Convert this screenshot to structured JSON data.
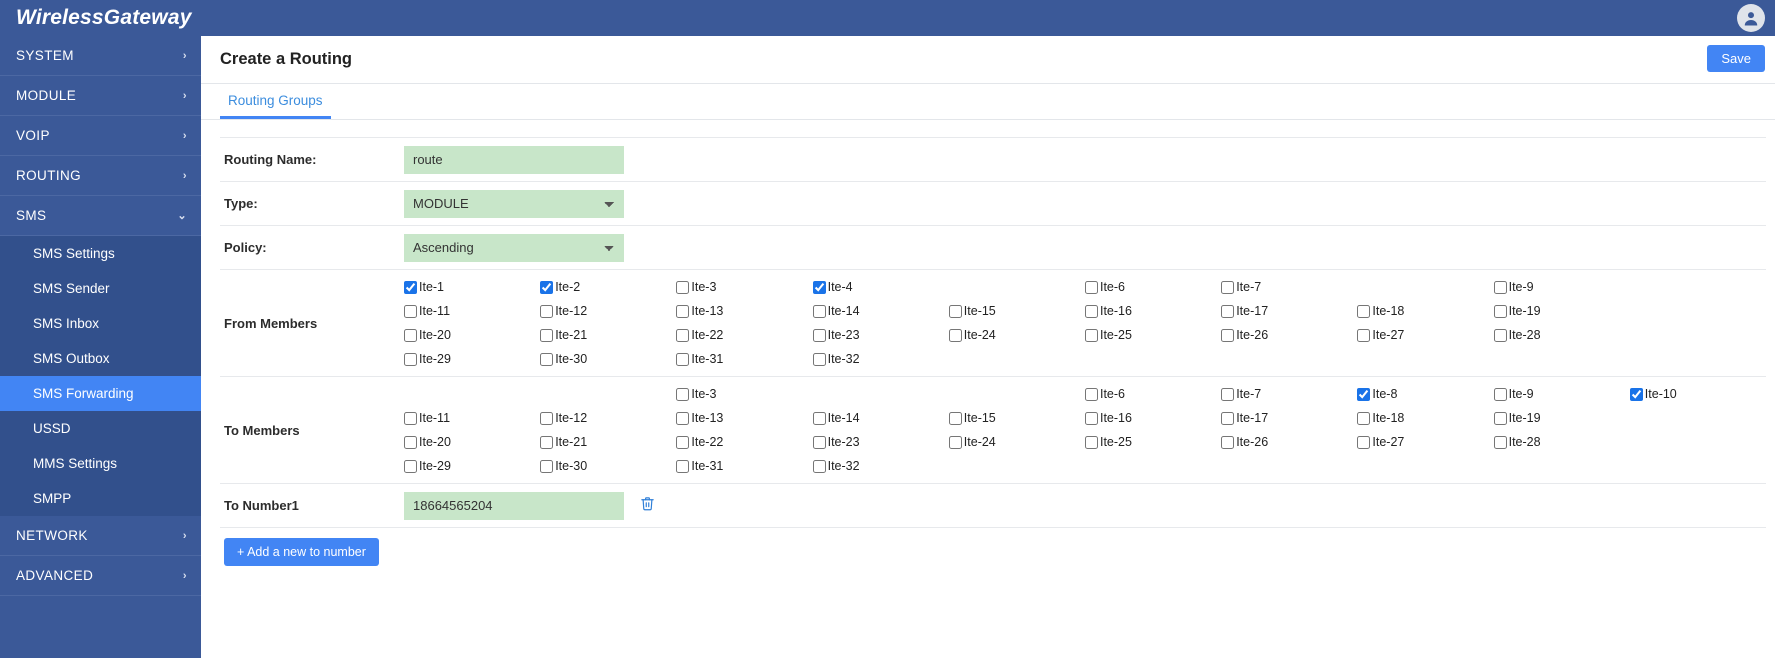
{
  "app": {
    "brand": "WirelessGateway",
    "user_icon": "user-avatar-icon"
  },
  "sidebar": {
    "groups": [
      {
        "label": "SYSTEM",
        "icon": "chevron-right-icon",
        "expanded": false,
        "children": []
      },
      {
        "label": "MODULE",
        "icon": "chevron-right-icon",
        "expanded": false,
        "children": []
      },
      {
        "label": "VOIP",
        "icon": "chevron-right-icon",
        "expanded": false,
        "children": []
      },
      {
        "label": "ROUTING",
        "icon": "chevron-right-icon",
        "expanded": false,
        "children": []
      },
      {
        "label": "SMS",
        "icon": "chevron-down-icon",
        "expanded": true,
        "children": [
          {
            "label": "SMS Settings",
            "active": false
          },
          {
            "label": "SMS Sender",
            "active": false
          },
          {
            "label": "SMS Inbox",
            "active": false
          },
          {
            "label": "SMS Outbox",
            "active": false
          },
          {
            "label": "SMS Forwarding",
            "active": true
          },
          {
            "label": "USSD",
            "active": false
          },
          {
            "label": "MMS Settings",
            "active": false
          },
          {
            "label": "SMPP",
            "active": false
          }
        ]
      },
      {
        "label": "NETWORK",
        "icon": "chevron-right-icon",
        "expanded": false,
        "children": []
      },
      {
        "label": "ADVANCED",
        "icon": "chevron-right-icon",
        "expanded": false,
        "children": []
      }
    ]
  },
  "page": {
    "title": "Create a Routing",
    "save_label": "Save",
    "tabs": [
      {
        "label": "Routing Groups",
        "active": true
      }
    ]
  },
  "form": {
    "routing_name": {
      "label": "Routing Name:",
      "value": "route",
      "placeholder": ""
    },
    "type": {
      "label": "Type:",
      "value": "MODULE",
      "options": [
        "MODULE"
      ]
    },
    "policy": {
      "label": "Policy:",
      "value": "Ascending",
      "options": [
        "Ascending"
      ]
    },
    "from_members": {
      "label": "From Members",
      "columns": 10,
      "cells": [
        {
          "label": "Ite-1",
          "checked": true
        },
        {
          "label": "Ite-2",
          "checked": true
        },
        {
          "label": "Ite-3",
          "checked": false
        },
        {
          "label": "Ite-4",
          "checked": true
        },
        {
          "label": "",
          "checked": false,
          "empty": true
        },
        {
          "label": "Ite-6",
          "checked": false
        },
        {
          "label": "Ite-7",
          "checked": false
        },
        {
          "label": "",
          "checked": false,
          "empty": true
        },
        {
          "label": "Ite-9",
          "checked": false
        },
        {
          "label": "",
          "checked": false,
          "empty": true
        },
        {
          "label": "Ite-11",
          "checked": false
        },
        {
          "label": "Ite-12",
          "checked": false
        },
        {
          "label": "Ite-13",
          "checked": false
        },
        {
          "label": "Ite-14",
          "checked": false
        },
        {
          "label": "Ite-15",
          "checked": false
        },
        {
          "label": "Ite-16",
          "checked": false
        },
        {
          "label": "Ite-17",
          "checked": false
        },
        {
          "label": "Ite-18",
          "checked": false
        },
        {
          "label": "Ite-19",
          "checked": false
        },
        {
          "label": "",
          "checked": false,
          "empty": true
        },
        {
          "label": "Ite-20",
          "checked": false
        },
        {
          "label": "Ite-21",
          "checked": false
        },
        {
          "label": "Ite-22",
          "checked": false
        },
        {
          "label": "Ite-23",
          "checked": false
        },
        {
          "label": "Ite-24",
          "checked": false
        },
        {
          "label": "Ite-25",
          "checked": false
        },
        {
          "label": "Ite-26",
          "checked": false
        },
        {
          "label": "Ite-27",
          "checked": false
        },
        {
          "label": "Ite-28",
          "checked": false
        },
        {
          "label": "",
          "checked": false,
          "empty": true
        },
        {
          "label": "Ite-29",
          "checked": false
        },
        {
          "label": "Ite-30",
          "checked": false
        },
        {
          "label": "Ite-31",
          "checked": false
        },
        {
          "label": "Ite-32",
          "checked": false
        },
        {
          "label": "",
          "checked": false,
          "empty": true
        },
        {
          "label": "",
          "checked": false,
          "empty": true
        },
        {
          "label": "",
          "checked": false,
          "empty": true
        },
        {
          "label": "",
          "checked": false,
          "empty": true
        },
        {
          "label": "",
          "checked": false,
          "empty": true
        },
        {
          "label": "",
          "checked": false,
          "empty": true
        }
      ]
    },
    "to_members": {
      "label": "To Members",
      "columns": 10,
      "cells": [
        {
          "label": "",
          "checked": false,
          "empty": true
        },
        {
          "label": "",
          "checked": false,
          "empty": true
        },
        {
          "label": "Ite-3",
          "checked": false
        },
        {
          "label": "",
          "checked": false,
          "empty": true
        },
        {
          "label": "",
          "checked": false,
          "empty": true
        },
        {
          "label": "Ite-6",
          "checked": false
        },
        {
          "label": "Ite-7",
          "checked": false
        },
        {
          "label": "Ite-8",
          "checked": true
        },
        {
          "label": "Ite-9",
          "checked": false
        },
        {
          "label": "Ite-10",
          "checked": true
        },
        {
          "label": "Ite-11",
          "checked": false
        },
        {
          "label": "Ite-12",
          "checked": false
        },
        {
          "label": "Ite-13",
          "checked": false
        },
        {
          "label": "Ite-14",
          "checked": false
        },
        {
          "label": "Ite-15",
          "checked": false
        },
        {
          "label": "Ite-16",
          "checked": false
        },
        {
          "label": "Ite-17",
          "checked": false
        },
        {
          "label": "Ite-18",
          "checked": false
        },
        {
          "label": "Ite-19",
          "checked": false
        },
        {
          "label": "",
          "checked": false,
          "empty": true
        },
        {
          "label": "Ite-20",
          "checked": false
        },
        {
          "label": "Ite-21",
          "checked": false
        },
        {
          "label": "Ite-22",
          "checked": false
        },
        {
          "label": "Ite-23",
          "checked": false
        },
        {
          "label": "Ite-24",
          "checked": false
        },
        {
          "label": "Ite-25",
          "checked": false
        },
        {
          "label": "Ite-26",
          "checked": false
        },
        {
          "label": "Ite-27",
          "checked": false
        },
        {
          "label": "Ite-28",
          "checked": false
        },
        {
          "label": "",
          "checked": false,
          "empty": true
        },
        {
          "label": "Ite-29",
          "checked": false
        },
        {
          "label": "Ite-30",
          "checked": false
        },
        {
          "label": "Ite-31",
          "checked": false
        },
        {
          "label": "Ite-32",
          "checked": false
        },
        {
          "label": "",
          "checked": false,
          "empty": true
        },
        {
          "label": "",
          "checked": false,
          "empty": true
        },
        {
          "label": "",
          "checked": false,
          "empty": true
        },
        {
          "label": "",
          "checked": false,
          "empty": true
        },
        {
          "label": "",
          "checked": false,
          "empty": true
        },
        {
          "label": "",
          "checked": false,
          "empty": true
        }
      ]
    },
    "to_number1": {
      "label": "To Number1",
      "value": "18664565204",
      "placeholder": "",
      "delete_icon": "trash-icon"
    },
    "add_number_label": "+ Add a new to number"
  },
  "colors": {
    "brand_blue": "#3b5998",
    "accent_blue": "#4285f4",
    "input_green": "#c8e6c9",
    "active_item": "#4285f4"
  }
}
